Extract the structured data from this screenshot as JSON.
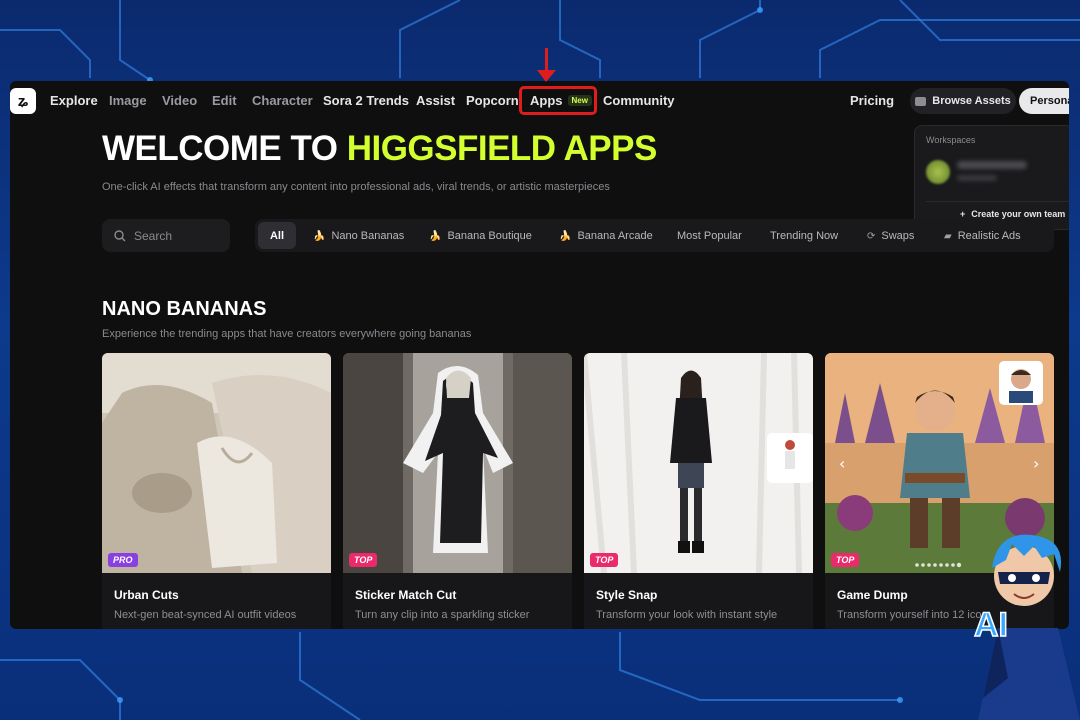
{
  "nav": {
    "items": [
      {
        "label": "Explore",
        "active": true
      },
      {
        "label": "Image"
      },
      {
        "label": "Video"
      },
      {
        "label": "Edit"
      },
      {
        "label": "Character"
      },
      {
        "label": "Sora 2 Trends",
        "active": true
      },
      {
        "label": "Assist",
        "active": true
      },
      {
        "label": "Popcorn",
        "active": true
      },
      {
        "label": "Apps",
        "active": true,
        "badge": "New"
      },
      {
        "label": "Community",
        "active": true
      }
    ],
    "pricing": "Pricing",
    "browse_assets": "Browse Assets",
    "personal": "Personal"
  },
  "workspaces": {
    "title": "Workspaces",
    "create": "Create your own team"
  },
  "hero": {
    "title_plain": "WELCOME TO ",
    "title_accent": "HIGGSFIELD APPS",
    "subtitle": "One-click AI effects that transform any content into professional ads, viral trends, or artistic masterpieces"
  },
  "search": {
    "placeholder": "Search"
  },
  "filters": {
    "all": "All",
    "items": [
      "Nano Bananas",
      "Banana Boutique",
      "Banana Arcade",
      "Most Popular",
      "Trending Now",
      "Swaps",
      "Realistic Ads"
    ]
  },
  "section": {
    "title": "NANO BANANAS",
    "subtitle": "Experience the trending apps that have creators everywhere going bananas"
  },
  "cards": [
    {
      "name": "Urban Cuts",
      "desc": "Next-gen beat-synced AI outfit videos",
      "badge": "PRO"
    },
    {
      "name": "Sticker Match Cut",
      "desc": "Turn any clip into a sparkling sticker",
      "badge": "TOP"
    },
    {
      "name": "Style Snap",
      "desc": "Transform your look with instant style",
      "badge": "TOP"
    },
    {
      "name": "Game Dump",
      "desc": "Transform yourself into 12 ico",
      "badge": "TOP"
    }
  ],
  "mascot": {
    "label": "AI"
  },
  "colors": {
    "accent": "#d4ff2f",
    "highlight": "#e01d1d",
    "pro": "#8a3fe0",
    "top": "#ea2a6b"
  }
}
